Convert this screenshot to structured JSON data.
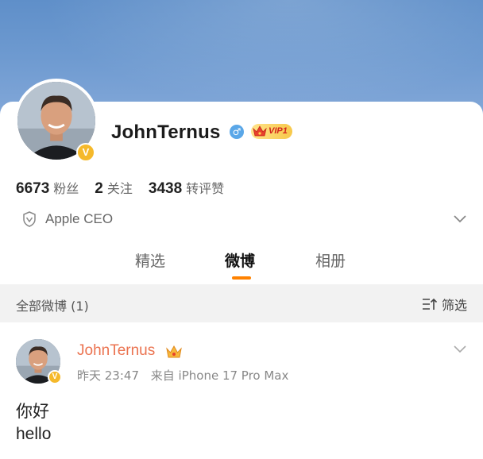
{
  "profile": {
    "username": "JohnTernus",
    "gender_symbol": "♂",
    "vip_label": "VIP1",
    "verified_mark": "V",
    "stats": [
      {
        "value": "6673",
        "label": "粉丝"
      },
      {
        "value": "2",
        "label": "关注"
      },
      {
        "value": "3438",
        "label": "转评赞"
      }
    ],
    "bio": "Apple CEO"
  },
  "tabs": [
    {
      "label": "精选",
      "active": false
    },
    {
      "label": "微博",
      "active": true
    },
    {
      "label": "相册",
      "active": false
    }
  ],
  "filter_bar": {
    "title": "全部微博 (1)",
    "filter_label": "筛选"
  },
  "post": {
    "author": "JohnTernus",
    "time": "昨天 23:47",
    "source": "来自 iPhone 17 Pro Max",
    "lines": [
      "你好",
      "hello"
    ]
  },
  "colors": {
    "accent_orange": "#ff8200",
    "author_name": "#eb7350",
    "verified_gold": "#f5b92b",
    "gender_blue": "#5aa7e8",
    "banner_blue": "#6e9ad0"
  },
  "icons": [
    "shield-icon",
    "chevron-down-icon",
    "filter-icon",
    "crown-icon",
    "male-icon",
    "verified-icon"
  ]
}
